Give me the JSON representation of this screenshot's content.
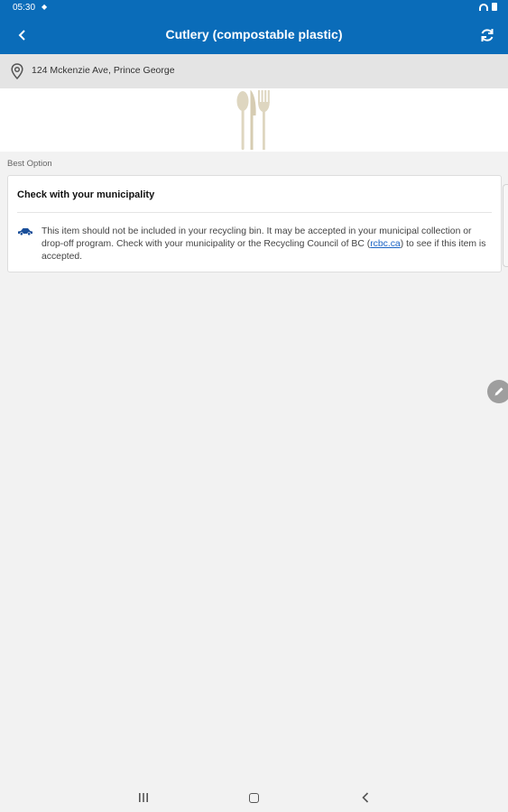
{
  "status_bar": {
    "time": "05:30",
    "dot": "◆"
  },
  "app_bar": {
    "title": "Cutlery (compostable plastic)",
    "back_icon": "chevron-left-icon",
    "refresh_icon": "refresh-icon"
  },
  "location": {
    "address": "124 Mckenzie Ave, Prince George",
    "icon": "location-pin-icon"
  },
  "hero": {
    "image": "cutlery-spoon-knife-fork"
  },
  "best_option": {
    "section_label": "Best Option",
    "title": "Check with your municipality",
    "icon": "car-icon",
    "body_before_link": "This item should not be included in your recycling bin. It may be accepted in your municipal collection or drop-off program. Check with your municipality or the Recycling Council of BC (",
    "link_text": "rcbc.ca",
    "body_after_link": ") to see if this item is accepted."
  },
  "colors": {
    "primary": "#0a6cb9",
    "link": "#1a63c4",
    "fab": "#9e9e9e",
    "utensil": "#ded6c0"
  }
}
